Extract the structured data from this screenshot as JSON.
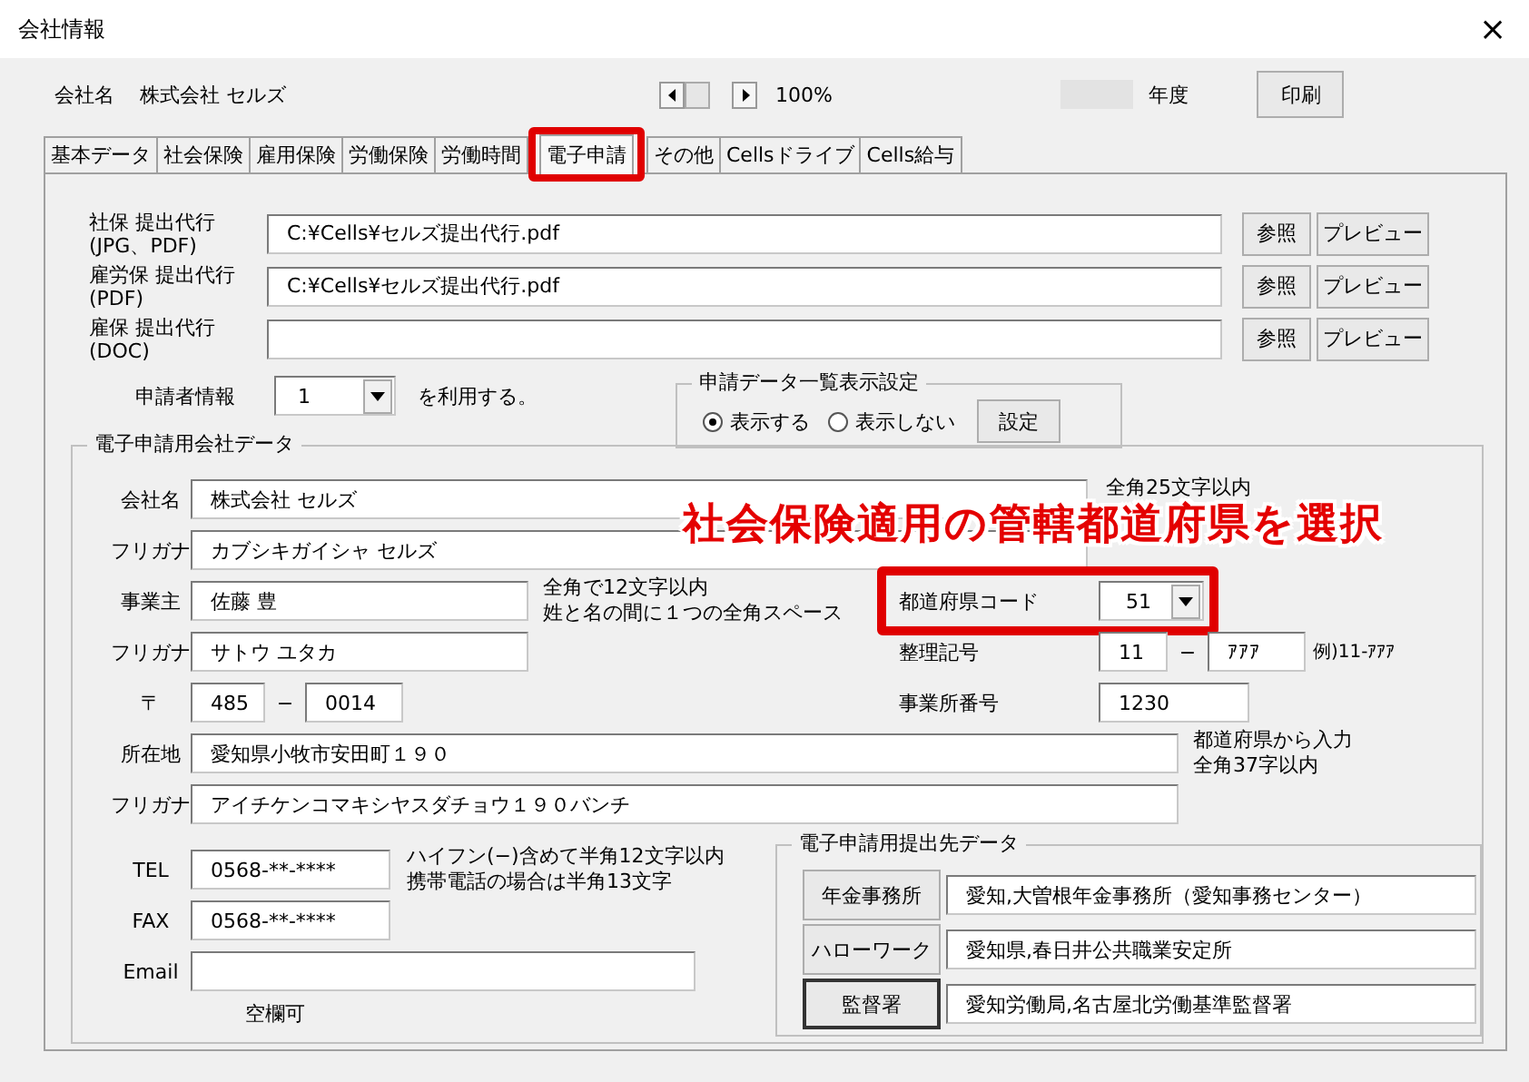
{
  "window": {
    "title": "会社情報",
    "close": "×"
  },
  "header": {
    "company_label": "会社名",
    "company_name": "株式会社 セルズ",
    "zoom": "100%",
    "year_label": "年度",
    "print_button": "印刷"
  },
  "tabs": [
    {
      "label": "基本データ",
      "selected": false
    },
    {
      "label": "社会保険",
      "selected": false
    },
    {
      "label": "雇用保険",
      "selected": false
    },
    {
      "label": "労働保険",
      "selected": false
    },
    {
      "label": "労働時間",
      "selected": false
    },
    {
      "label": "電子申請",
      "selected": true
    },
    {
      "label": "その他",
      "selected": false
    },
    {
      "label": "Cellsドライブ",
      "selected": false
    },
    {
      "label": "Cells給与",
      "selected": false
    }
  ],
  "attachments": [
    {
      "label": "社保 提出代行",
      "sublabel": "(JPG、PDF)",
      "value": "C:¥Cells¥セルズ提出代行.pdf",
      "browse": "参照",
      "preview": "プレビュー"
    },
    {
      "label": "雇労保 提出代行",
      "sublabel": "(PDF)",
      "value": "C:¥Cells¥セルズ提出代行.pdf",
      "browse": "参照",
      "preview": "プレビュー"
    },
    {
      "label": "雇保 提出代行",
      "sublabel": "(DOC)",
      "browse": "参照",
      "preview": "プレビュー"
    }
  ],
  "applicant": {
    "label": "申請者情報",
    "value": "1",
    "suffix": "を利用する。"
  },
  "list_display": {
    "title": "申請データ一覧表示設定",
    "options": [
      {
        "label": "表示する",
        "selected": true
      },
      {
        "label": "表示しない",
        "selected": false
      }
    ],
    "button": "設定"
  },
  "company_data": {
    "title": "電子申請用会社データ",
    "name": {
      "label": "会社名",
      "value": "株式会社 セルズ",
      "note": "全角25文字以内"
    },
    "name_kana": {
      "label": "フリガナ",
      "value": "カブシキガイシャ セルズ"
    },
    "owner": {
      "label": "事業主",
      "value": "佐藤 豊",
      "notes": [
        "全角で12文字以内",
        "姓と名の間に１つの全角スペース"
      ]
    },
    "owner_kana": {
      "label": "フリガナ",
      "value": "サトウ ユタカ"
    },
    "postal": {
      "label": "〒",
      "first": "485",
      "dash": "−",
      "second": "0014"
    },
    "prefecture_code": {
      "label": "都道府県コード",
      "value": "51"
    },
    "reference_no": {
      "label": "整理記号",
      "first": "11",
      "dash": "−",
      "second": "ｱｱｱ",
      "example": "例)11-ｱｱｱ"
    },
    "office_no": {
      "label": "事業所番号",
      "value": "1230"
    },
    "address": {
      "label": "所在地",
      "value": "愛知県小牧市安田町１９０",
      "notes": [
        "都道府県から入力",
        "全角37字以内"
      ]
    },
    "address_kana": {
      "label": "フリガナ",
      "value": "アイチケンコマキシヤスダチョウ１９０バンチ"
    },
    "tel": {
      "label": "TEL",
      "value": "0568-**-****",
      "notes": [
        "ハイフン(−)含めて半角12文字以内",
        "携帯電話の場合は半角13文字"
      ]
    },
    "fax": {
      "label": "FAX",
      "value": "0568-**-****"
    },
    "email": {
      "label": "Email",
      "note": "空欄可"
    }
  },
  "submit_to": {
    "title": "電子申請用提出先データ",
    "rows": [
      {
        "button": "年金事務所",
        "value": "愛知,大曽根年金事務所（愛知事務センター）",
        "default": false
      },
      {
        "button": "ハローワーク",
        "value": "愛知県,春日井公共職業安定所",
        "default": false
      },
      {
        "button": "監督署",
        "value": "愛知労働局,名古屋北労働基準監督署",
        "default": true
      }
    ]
  },
  "annotation": {
    "text": "社会保険適用の管轄都道府県を選択"
  }
}
